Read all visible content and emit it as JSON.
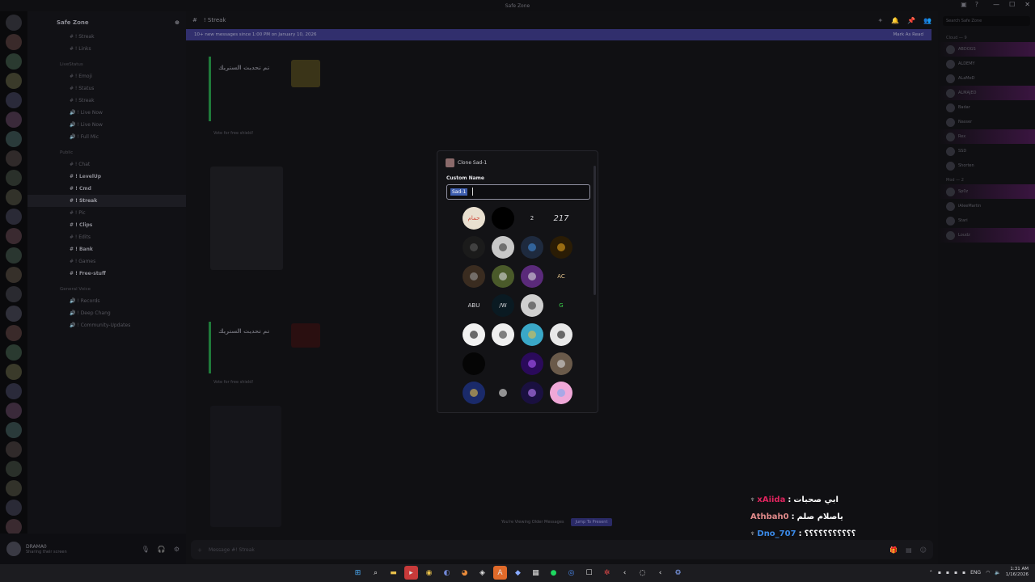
{
  "window": {
    "title": "Safe Zone",
    "controls": [
      "—",
      "☐",
      "✕"
    ]
  },
  "channels": {
    "server_name": "Safe Zone",
    "items": [
      {
        "label": "# ! Streak",
        "type": "chan"
      },
      {
        "label": "# ! Links",
        "type": "chan"
      },
      {
        "label": "LiveStatus",
        "type": "cat"
      },
      {
        "label": "# ! Emoji",
        "type": "chan"
      },
      {
        "label": "# ! Status",
        "type": "chan"
      },
      {
        "label": "# ! Streak",
        "type": "chan"
      },
      {
        "label": "🔊 ! Live Now",
        "type": "chan"
      },
      {
        "label": "🔊 ! Live Now",
        "type": "chan"
      },
      {
        "label": "🔊 ! Full Mic",
        "type": "chan"
      },
      {
        "label": "Public",
        "type": "cat"
      },
      {
        "label": "# ! Chat",
        "type": "chan"
      },
      {
        "label": "# ! LevelUp",
        "type": "bold"
      },
      {
        "label": "# ! Cmd",
        "type": "bold"
      },
      {
        "label": "# ! Streak",
        "type": "active"
      },
      {
        "label": "# ! Pic",
        "type": "chan"
      },
      {
        "label": "# ! Clips",
        "type": "bold"
      },
      {
        "label": "# ! Edits",
        "type": "chan"
      },
      {
        "label": "# ! Bank",
        "type": "bold"
      },
      {
        "label": "# ! Games",
        "type": "chan"
      },
      {
        "label": "# ! Free-stuff",
        "type": "bold"
      },
      {
        "label": "General Voice",
        "type": "cat"
      },
      {
        "label": "🔊 ! Records",
        "type": "chan"
      },
      {
        "label": "🔊 ! Deep Chang",
        "type": "chan"
      },
      {
        "label": "🔊 ! Community-Updates",
        "type": "chan"
      }
    ]
  },
  "user_panel": {
    "name": "DRAMA0",
    "status": "Sharing their screen"
  },
  "chat": {
    "channel": "! Streak",
    "banner_left": "10+ new messages since 1:00 PM on January 10, 2026",
    "banner_right": "Mark As Read",
    "streak_title": "تم تحديث الستريك",
    "vote_text": "Vote for free shield!",
    "viewing_text": "You're Viewing Older Messages",
    "jump_text": "Jump To Present",
    "composer_placeholder": "Message #! Streak"
  },
  "members": {
    "search_placeholder": "Search Safe Zone",
    "categories": [
      "Cloud — 9",
      "Mod — 2"
    ],
    "names": [
      "ABDOGS",
      "ALDEMY",
      "ALaMeD",
      "ALMAJED",
      "Badar",
      "Nasser",
      "Rex",
      "SSD",
      "Shorten",
      "Sp0z",
      "iAleeMartin",
      "Stari",
      "Loudz"
    ]
  },
  "modal": {
    "header_title": "Clone Sad-1",
    "field_label": "Custom Name",
    "input_value": "Sad-1",
    "avatars": [
      {
        "name": "avatar-arabic-logo",
        "bg": "#e9e0d0",
        "fg": "#d04a3a",
        "text": "حمام"
      },
      {
        "name": "avatar-black",
        "bg": "#000000",
        "fg": "#000000",
        "text": ""
      },
      {
        "name": "avatar-number-2",
        "bg": "transparent",
        "fg": "#d8d8dc",
        "text": "2"
      },
      {
        "name": "avatar-217",
        "bg": "transparent",
        "fg": "#d8d8dc",
        "text": "217"
      },
      {
        "name": "avatar-dark-plant",
        "bg": "#1b1b1b",
        "fg": "#5a5a5a",
        "text": ""
      },
      {
        "name": "avatar-ghost",
        "bg": "#c8c8c8",
        "fg": "#333",
        "text": ""
      },
      {
        "name": "avatar-blue-logo",
        "bg": "#1e2a3e",
        "fg": "#3f8ad8",
        "text": ""
      },
      {
        "name": "avatar-gold-swirl",
        "bg": "#2a1c05",
        "fg": "#e5a11a",
        "text": ""
      },
      {
        "name": "avatar-person-dark",
        "bg": "#3a2c20",
        "fg": "#999",
        "text": ""
      },
      {
        "name": "avatar-green-poster",
        "bg": "#4a5a2a",
        "fg": "#d8d8dc",
        "text": ""
      },
      {
        "name": "avatar-purple-person",
        "bg": "#5a2a7a",
        "fg": "#d8d8dc",
        "text": ""
      },
      {
        "name": "avatar-ac-logo",
        "bg": "transparent",
        "fg": "#e0c08a",
        "text": "AC"
      },
      {
        "name": "avatar-abu",
        "bg": "transparent",
        "fg": "#d8d8dc",
        "text": "ABU"
      },
      {
        "name": "avatar-aw-logo",
        "bg": "#0a1a22",
        "fg": "#d8d8dc",
        "text": "/W"
      },
      {
        "name": "avatar-soccer-ball",
        "bg": "#cfcfcf",
        "fg": "#333",
        "text": ""
      },
      {
        "name": "avatar-green-g",
        "bg": "transparent",
        "fg": "#3ad04a",
        "text": "G"
      },
      {
        "name": "avatar-white-bird",
        "bg": "#f2f2f2",
        "fg": "#111",
        "text": ""
      },
      {
        "name": "avatar-script-logo",
        "bg": "#efefef",
        "fg": "#333",
        "text": ""
      },
      {
        "name": "avatar-tower",
        "bg": "#3aa8c8",
        "fg": "#e5c04a",
        "text": ""
      },
      {
        "name": "avatar-anime-bw",
        "bg": "#e8e8e8",
        "fg": "#111",
        "text": ""
      },
      {
        "name": "avatar-black-circle",
        "bg": "#050505",
        "fg": "#050505",
        "text": ""
      },
      {
        "name": "avatar-empty",
        "bg": "transparent",
        "fg": "transparent",
        "text": ""
      },
      {
        "name": "avatar-purple-mc",
        "bg": "#2a0a5a",
        "fg": "#b05aff",
        "text": ""
      },
      {
        "name": "avatar-character",
        "bg": "#6a5a4a",
        "fg": "#d8d8dc",
        "text": ""
      },
      {
        "name": "avatar-fbi-seal",
        "bg": "#1a2a6a",
        "fg": "#e5c04a",
        "text": ""
      },
      {
        "name": "avatar-white-glyph",
        "bg": "transparent",
        "fg": "#e8e8e8",
        "text": ""
      },
      {
        "name": "avatar-purple-a",
        "bg": "#1a1040",
        "fg": "#c080ff",
        "text": ""
      },
      {
        "name": "avatar-pink-heart",
        "bg": "#f0a8d8",
        "fg": "#7aa8f0",
        "text": ""
      }
    ]
  },
  "overlay": {
    "lines": [
      {
        "user": "xAiida",
        "user_color": "#e0245e",
        "text": "ابي صحبات"
      },
      {
        "user": "Athbah0",
        "user_color": "#e08a8a",
        "text": "ياصلام صلم"
      },
      {
        "user": "Dno_707",
        "user_color": "#3a8ae8",
        "text": "؟؟؟؟؟؟؟؟؟؟؟"
      }
    ]
  },
  "taskbar": {
    "lang": "ENG",
    "time": "1:31 AM",
    "date": "1/16/2026"
  }
}
